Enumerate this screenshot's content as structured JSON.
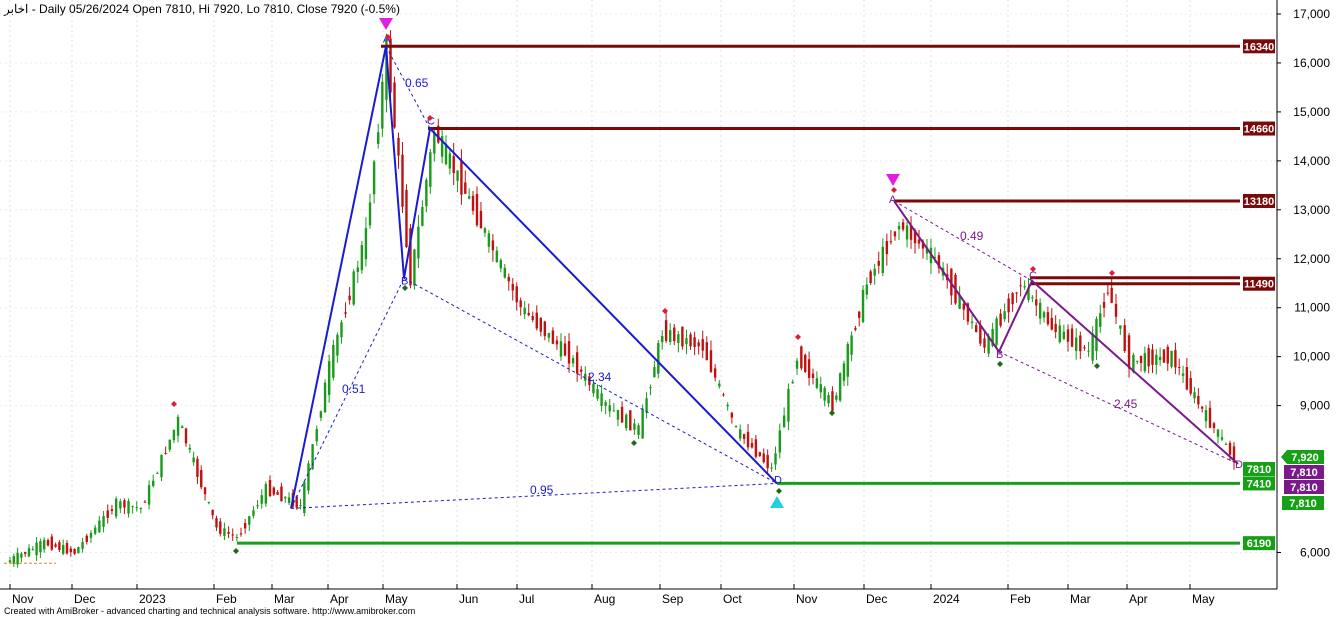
{
  "header": {
    "text": "اخابر - Daily 05/26/2024 Open 7810, Hi 7920, Lo 7810, Close 7920 (-0.5%)"
  },
  "footer": {
    "text": "Created with AmiBroker - advanced charting and technical analysis software. http://www.amibroker.com"
  },
  "colors": {
    "resistance": "#7a0a0a",
    "support": "#16a016",
    "pattern_blue": "#1a1ad6",
    "pattern_purple": "#7a1a8a",
    "candle_up": "#1a9a1a",
    "candle_down": "#c01010",
    "marker_magenta": "#e020e0",
    "marker_cyan": "#20d0e0"
  },
  "chart_data": {
    "type": "candlestick",
    "ylim": [
      5300,
      17200
    ],
    "y_ticks": [
      {
        "value": 6000,
        "label": "6,000"
      },
      {
        "value": 9000,
        "label": "9,000"
      },
      {
        "value": 10000,
        "label": "10,000"
      },
      {
        "value": 11000,
        "label": "11,000"
      },
      {
        "value": 12000,
        "label": "12,000"
      },
      {
        "value": 13000,
        "label": "13,000"
      },
      {
        "value": 14000,
        "label": "14,000"
      },
      {
        "value": 15000,
        "label": "15,000"
      },
      {
        "value": 16000,
        "label": "16,000"
      },
      {
        "value": 17000,
        "label": "17,000"
      }
    ],
    "x_labels": [
      "Nov",
      "Dec",
      "2023",
      "Feb",
      "Mar",
      "Apr",
      "May",
      "Jun",
      "Jul",
      "Aug",
      "Sep",
      "Oct",
      "Nov",
      "Dec",
      "2024",
      "Feb",
      "Mar",
      "Apr",
      "May"
    ],
    "close_series": [
      {
        "date": "2022-11-01",
        "close": 5800
      },
      {
        "date": "2022-11-20",
        "close": 6200
      },
      {
        "date": "2022-12-05",
        "close": 6000
      },
      {
        "date": "2022-12-25",
        "close": 7000
      },
      {
        "date": "2023-01-05",
        "close": 6900
      },
      {
        "date": "2023-01-20",
        "close": 8700
      },
      {
        "date": "2023-02-05",
        "close": 6500
      },
      {
        "date": "2023-02-15",
        "close": 6300
      },
      {
        "date": "2023-03-01",
        "close": 7300
      },
      {
        "date": "2023-03-20",
        "close": 6950
      },
      {
        "date": "2023-04-05",
        "close": 9800
      },
      {
        "date": "2023-04-25",
        "close": 12500
      },
      {
        "date": "2023-05-05",
        "close": 16300
      },
      {
        "date": "2023-05-15",
        "close": 11600
      },
      {
        "date": "2023-05-25",
        "close": 14600
      },
      {
        "date": "2023-06-10",
        "close": 13200
      },
      {
        "date": "2023-07-05",
        "close": 11000
      },
      {
        "date": "2023-07-25",
        "close": 10000
      },
      {
        "date": "2023-08-10",
        "close": 9000
      },
      {
        "date": "2023-08-25",
        "close": 8500
      },
      {
        "date": "2023-09-05",
        "close": 10500
      },
      {
        "date": "2023-09-25",
        "close": 10200
      },
      {
        "date": "2023-10-10",
        "close": 8500
      },
      {
        "date": "2023-10-25",
        "close": 7700
      },
      {
        "date": "2023-11-05",
        "close": 10000
      },
      {
        "date": "2023-11-20",
        "close": 9000
      },
      {
        "date": "2023-12-05",
        "close": 11500
      },
      {
        "date": "2023-12-20",
        "close": 12700
      },
      {
        "date": "2024-01-05",
        "close": 12000
      },
      {
        "date": "2024-01-25",
        "close": 10200
      },
      {
        "date": "2024-02-10",
        "close": 11500
      },
      {
        "date": "2024-02-25",
        "close": 10600
      },
      {
        "date": "2024-03-15",
        "close": 10100
      },
      {
        "date": "2024-03-25",
        "close": 11400
      },
      {
        "date": "2024-04-05",
        "close": 9900
      },
      {
        "date": "2024-04-25",
        "close": 10000
      },
      {
        "date": "2024-05-10",
        "close": 8900
      },
      {
        "date": "2024-05-26",
        "close": 7920
      }
    ],
    "levels": [
      {
        "value": 16340,
        "label": "16340",
        "kind": "resistance"
      },
      {
        "value": 14660,
        "label": "14660",
        "kind": "resistance"
      },
      {
        "value": 13180,
        "label": "13180",
        "kind": "resistance"
      },
      {
        "value": 11490,
        "label": "11490",
        "kind": "resistance"
      },
      {
        "value": 7410,
        "label": "7410",
        "kind": "support"
      },
      {
        "value": 6190,
        "label": "6190",
        "kind": "support"
      }
    ],
    "price_tags": [
      {
        "value": 7920,
        "label": "7,920",
        "color": "#16a016"
      },
      {
        "value": 7810,
        "label": "7810",
        "color": "#16a016"
      },
      {
        "value": 7810,
        "label": "7,810",
        "color": "#7a1a8a"
      },
      {
        "value": 7810,
        "label": "7,810",
        "color": "#7a1a8a"
      },
      {
        "value": 7810,
        "label": "7,810",
        "color": "#16a016"
      }
    ],
    "pattern_points": [
      "A",
      "B",
      "C",
      "D"
    ],
    "ratios": [
      {
        "label": "0.65",
        "color": "blue"
      },
      {
        "label": "0.51",
        "color": "blue"
      },
      {
        "label": "2.34",
        "color": "blue"
      },
      {
        "label": "0.95",
        "color": "blue"
      },
      {
        "label": "0.49",
        "color": "purple"
      },
      {
        "label": "2.45",
        "color": "purple"
      }
    ]
  }
}
